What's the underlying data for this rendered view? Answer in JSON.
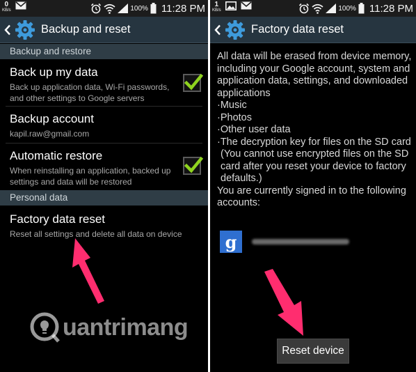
{
  "left_screen": {
    "status_bar": {
      "net_speed": "0",
      "net_unit": "KB/s",
      "battery": "100%",
      "time": "11:28 PM"
    },
    "action_bar": {
      "title": "Backup and reset"
    },
    "sections": {
      "backup_restore": "Backup and restore",
      "personal_data": "Personal data"
    },
    "items": {
      "backup_data": {
        "title": "Back up my data",
        "summary": "Back up application data, Wi-Fi passwords, and other settings to Google servers",
        "checked": true
      },
      "backup_account": {
        "title": "Backup account",
        "summary": "kapil.raw@gmail.com"
      },
      "auto_restore": {
        "title": "Automatic restore",
        "summary": "When reinstalling an application, backed up settings and data will be restored",
        "checked": true
      },
      "factory_reset": {
        "title": "Factory data reset",
        "summary": "Reset all settings and delete all data on device"
      }
    }
  },
  "right_screen": {
    "status_bar": {
      "net_speed": "1",
      "net_unit": "KB/s",
      "battery": "100%",
      "time": "11:28 PM"
    },
    "action_bar": {
      "title": "Factory data reset"
    },
    "intro": "All data will be erased from device memory, including your Google account, system and application data, settings, and downloaded applications",
    "list": [
      "·Music",
      "·Photos",
      "·Other user data",
      "·The decryption key for files on the SD card"
    ],
    "note": "(You cannot use encrypted files on the SD card after you reset your device to factory defaults.)",
    "signed_in": "You are currently signed in to the following accounts:",
    "account_icon": "g",
    "reset_button": "Reset device"
  },
  "watermark": {
    "text": "uantrimang",
    "icon": "Q-bulb-logo"
  },
  "colors": {
    "action_bar": "#263540",
    "section_header": "#2f3d46",
    "check": "#8fd31f",
    "arrow": "#ff2d6f"
  }
}
